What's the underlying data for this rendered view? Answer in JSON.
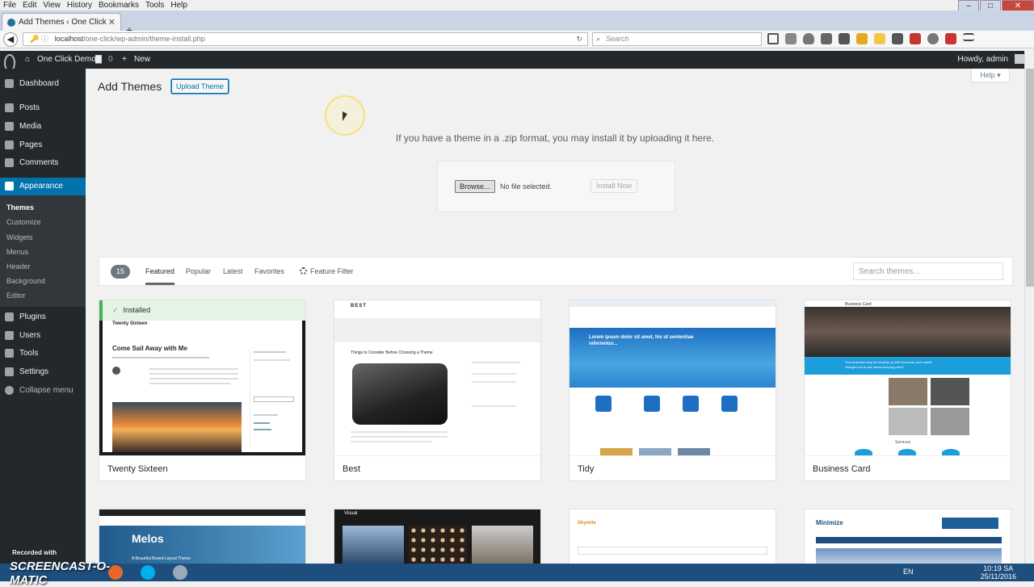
{
  "browser": {
    "menu": [
      "File",
      "Edit",
      "View",
      "History",
      "Bookmarks",
      "Tools",
      "Help"
    ],
    "tab_title": "Add Themes ‹ One Click Demo...",
    "url_host": "localhost",
    "url_path": "/one-click/wp-admin/theme-install.php",
    "search_placeholder": "Search"
  },
  "adminbar": {
    "site_name": "One Click Demo",
    "comments_count": "0",
    "new_label": "New",
    "howdy": "Howdy, admin"
  },
  "sidebar": {
    "items": [
      {
        "label": "Dashboard"
      },
      {
        "label": "Posts"
      },
      {
        "label": "Media"
      },
      {
        "label": "Pages"
      },
      {
        "label": "Comments"
      },
      {
        "label": "Appearance"
      },
      {
        "label": "Plugins"
      },
      {
        "label": "Users"
      },
      {
        "label": "Tools"
      },
      {
        "label": "Settings"
      },
      {
        "label": "Collapse menu"
      }
    ],
    "appearance_sub": [
      "Themes",
      "Customize",
      "Widgets",
      "Menus",
      "Header",
      "Background",
      "Editor"
    ]
  },
  "page": {
    "title": "Add Themes",
    "upload_button": "Upload Theme",
    "help": "Help ▾",
    "upload_desc": "If you have a theme in a .zip format, you may install it by uploading it here.",
    "browse": "Browse...",
    "no_file": "No file selected.",
    "install_now": "Install Now"
  },
  "filter": {
    "count": "15",
    "tabs": [
      "Featured",
      "Popular",
      "Latest",
      "Favorites"
    ],
    "feature_filter": "Feature Filter",
    "search_placeholder": "Search themes..."
  },
  "themes": [
    {
      "name": "Twenty Sixteen",
      "installed": "Installed"
    },
    {
      "name": "Best"
    },
    {
      "name": "Tidy"
    },
    {
      "name": "Business Card"
    }
  ],
  "previews": {
    "ts_header": "Twenty Sixteen",
    "ts_post": "Come Sail Away with Me",
    "best_logo": "BEST",
    "best_post": "Things to Consider Before Choosing a Theme",
    "tidy_hero": "Lorem ipsum dolor sit amet, his ut sententiae referrentur...",
    "bc_label": "Business Card",
    "bc_banner": "Your business may be keeping up with economic and market changes but is your brand keeping pace?",
    "bc_services": "Services",
    "melos_title": "Melos",
    "melos_sub": "A Beautiful Boxed Layout Theme",
    "visual_logo": "Visual",
    "skymile_logo": "Skymile",
    "minimize_logo": "Minimize"
  },
  "taskbar": {
    "watermark_line1": "Recorded with",
    "watermark_line2": "SCREENCAST-O-MATIC",
    "lang": "EN",
    "time": "10:19 SA",
    "date": "25/11/2016"
  },
  "colors": {
    "admin_dark": "#23282d",
    "accent": "#0073aa",
    "installed_green": "#46b450",
    "tidy_blue": "#1e6fc2",
    "business_blue": "#1b9ed9"
  }
}
